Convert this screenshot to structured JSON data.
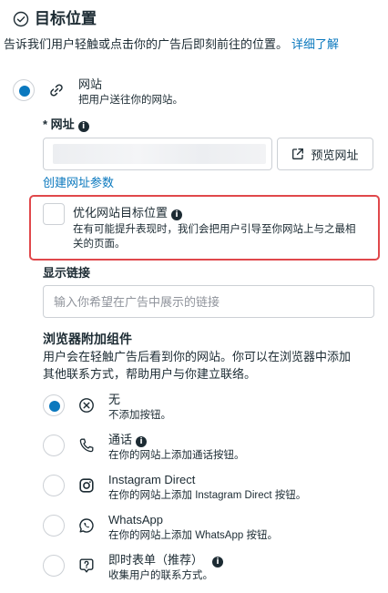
{
  "header": {
    "title": "目标位置",
    "description": "告诉我们用户轻触或点击你的广告后即刻前往的位置。",
    "learn_more": "详细了解"
  },
  "destination_option": {
    "title": "网站",
    "subtitle": "把用户送往你的网站。",
    "selected": true,
    "icon": "link-icon"
  },
  "url_field": {
    "label": "* 网址",
    "value": "",
    "preview_button": "预览网址",
    "build_params_link": "创建网址参数"
  },
  "optimize": {
    "title": "优化网站目标位置",
    "description_line1": "在有可能提升表现时，我们会把用户引导至你网站上与之最相",
    "description_line2": "关的页面。",
    "checked": false
  },
  "display_link": {
    "label": "显示链接",
    "placeholder": "输入你希望在广告中展示的链接"
  },
  "browser_addons": {
    "title": "浏览器附加组件",
    "description_line1": "用户会在轻触广告后看到你的网站。你可以在浏览器中添加",
    "description_line2": "其他联系方式，帮助用户与你建立联络。",
    "options": [
      {
        "title": "无",
        "subtitle": "不添加按钮。",
        "selected": true,
        "icon": "close-circle-icon"
      },
      {
        "title": "通话",
        "subtitle": "在你的网站上添加通话按钮。",
        "selected": false,
        "icon": "phone-icon"
      },
      {
        "title": "Instagram Direct",
        "subtitle": "在你的网站上添加 Instagram Direct 按钮。",
        "selected": false,
        "icon": "instagram-icon"
      },
      {
        "title": "WhatsApp",
        "subtitle": "在你的网站上添加 WhatsApp 按钮。",
        "selected": false,
        "icon": "whatsapp-icon"
      },
      {
        "title": "即时表单（推荐）",
        "subtitle": "收集用户的联系方式。",
        "selected": false,
        "icon": "form-question-icon"
      }
    ]
  },
  "colors": {
    "accent": "#0a78be",
    "highlight": "#e0484b",
    "text": "#1c2b33",
    "border": "#ccd0d5"
  }
}
